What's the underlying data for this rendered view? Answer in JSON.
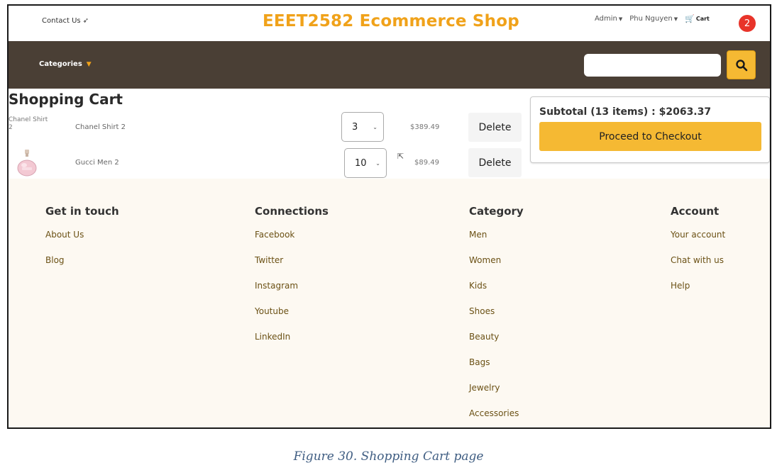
{
  "header": {
    "contact_label": "Contact Us",
    "brand": "EEET2582 Ecommerce Shop",
    "admin_label": "Admin",
    "user_label": "Phu Nguyen",
    "cart_label": "Cart",
    "cart_count": "2",
    "badge_color": "#e8342a",
    "brand_color": "#f0a21a"
  },
  "navbar": {
    "categories_label": "Categories",
    "search_placeholder": "",
    "bg_color": "#4a3f35",
    "accent_color": "#f5b933"
  },
  "cart": {
    "title": "Shopping Cart",
    "items": [
      {
        "image_alt": "Chanel Shirt 2",
        "name": "Chanel Shirt 2",
        "quantity": "3",
        "price": "$389.49",
        "delete_label": "Delete"
      },
      {
        "name": "Gucci Men 2",
        "quantity": "10",
        "price": "$89.49",
        "delete_label": "Delete"
      }
    ],
    "subtotal": "Subtotal (13 items) : $2063.37",
    "checkout_label": "Proceed to Checkout"
  },
  "footer": {
    "columns": [
      {
        "title": "Get in touch",
        "links": [
          "About Us",
          "Blog"
        ]
      },
      {
        "title": "Connections",
        "links": [
          "Facebook",
          "Twitter",
          "Instagram",
          "Youtube",
          "LinkedIn"
        ]
      },
      {
        "title": "Category",
        "links": [
          "Men",
          "Women",
          "Kids",
          "Shoes",
          "Beauty",
          "Bags",
          "Jewelry",
          "Accessories"
        ]
      },
      {
        "title": "Account",
        "links": [
          "Your account",
          "Chat with us",
          "Help"
        ]
      }
    ]
  },
  "caption": "Figure 30. Shopping Cart page"
}
